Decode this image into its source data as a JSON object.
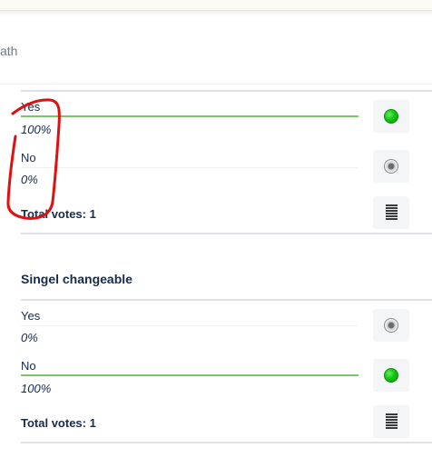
{
  "header": {
    "partial_text": "ath"
  },
  "polls": [
    {
      "title": "",
      "options": [
        {
          "label": "Yes",
          "percent": "100%",
          "selected": true
        },
        {
          "label": "No",
          "percent": "0%",
          "selected": false
        }
      ],
      "total_label": "Total votes: 1"
    },
    {
      "title": "Singel changeable",
      "options": [
        {
          "label": "Yes",
          "percent": "0%",
          "selected": false
        },
        {
          "label": "No",
          "percent": "100%",
          "selected": true
        }
      ],
      "total_label": "Total votes: 1"
    }
  ],
  "colors": {
    "winning_line": "#7bc56e",
    "selected_dot": "#16c316",
    "text": "#172b4d",
    "annotation": "#e01010"
  },
  "icons": {
    "selected": "green-radio-dot-icon",
    "unselected": "grey-radio-dot-icon",
    "results": "bar-list-icon"
  }
}
